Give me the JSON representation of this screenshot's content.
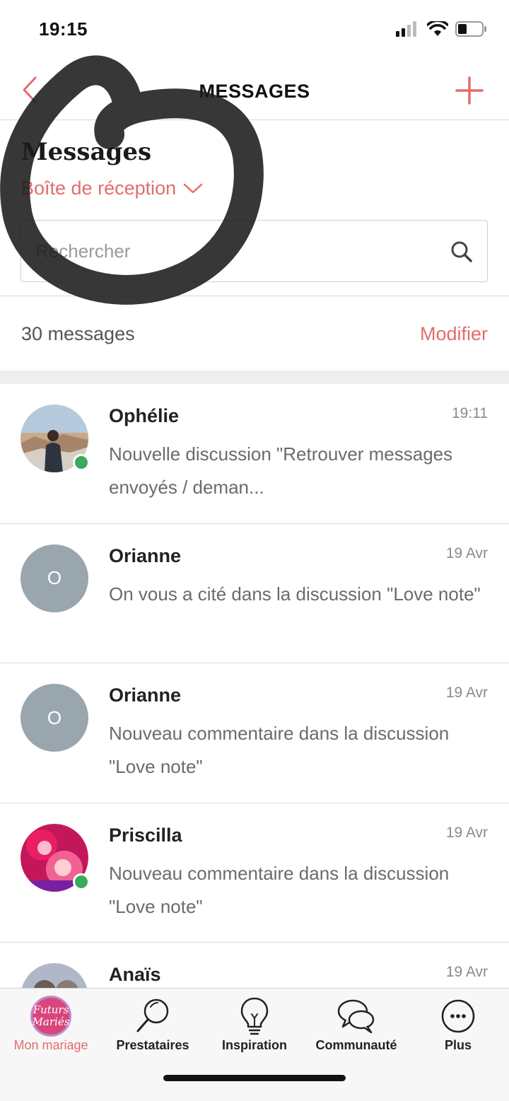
{
  "status_bar": {
    "time": "19:15"
  },
  "nav": {
    "title": "MESSAGES"
  },
  "header": {
    "heading": "Messages",
    "folder": "Boîte de réception",
    "search_placeholder": "Rechercher"
  },
  "list_header": {
    "count": "30 messages",
    "edit": "Modifier"
  },
  "messages": [
    {
      "name": "Ophélie",
      "time": "19:11",
      "preview": "Nouvelle discussion \"Retrouver messages envoyés / deman...",
      "online": true,
      "avatar": "photo"
    },
    {
      "name": "Orianne",
      "time": "19 Avr",
      "preview": "On vous a cité dans la discussion \"Love note\"",
      "online": false,
      "avatar": "O"
    },
    {
      "name": "Orianne",
      "time": "19 Avr",
      "preview": "Nouveau commentaire dans la discussion \"Love note\"",
      "online": false,
      "avatar": "O"
    },
    {
      "name": "Priscilla",
      "time": "19 Avr",
      "preview": "Nouveau commentaire dans la discussion \"Love note\"",
      "online": true,
      "avatar": "photo"
    },
    {
      "name": "Anaïs",
      "time": "19 Avr",
      "preview": "",
      "online": false,
      "avatar": "photo"
    }
  ],
  "tabs": [
    {
      "label": "Mon mariage",
      "icon": "futurs-maries-logo",
      "active": true,
      "logo_line1": "Futurs",
      "logo_line2": "Mariés"
    },
    {
      "label": "Prestataires",
      "icon": "magnifier-icon",
      "active": false
    },
    {
      "label": "Inspiration",
      "icon": "lightbulb-icon",
      "active": false
    },
    {
      "label": "Communauté",
      "icon": "chat-bubbles-icon",
      "active": false
    },
    {
      "label": "Plus",
      "icon": "more-icon",
      "active": false
    }
  ],
  "colors": {
    "accent": "#e46c6c",
    "online": "#3aaa5c",
    "avatar_placeholder": "#9aa6ae"
  }
}
